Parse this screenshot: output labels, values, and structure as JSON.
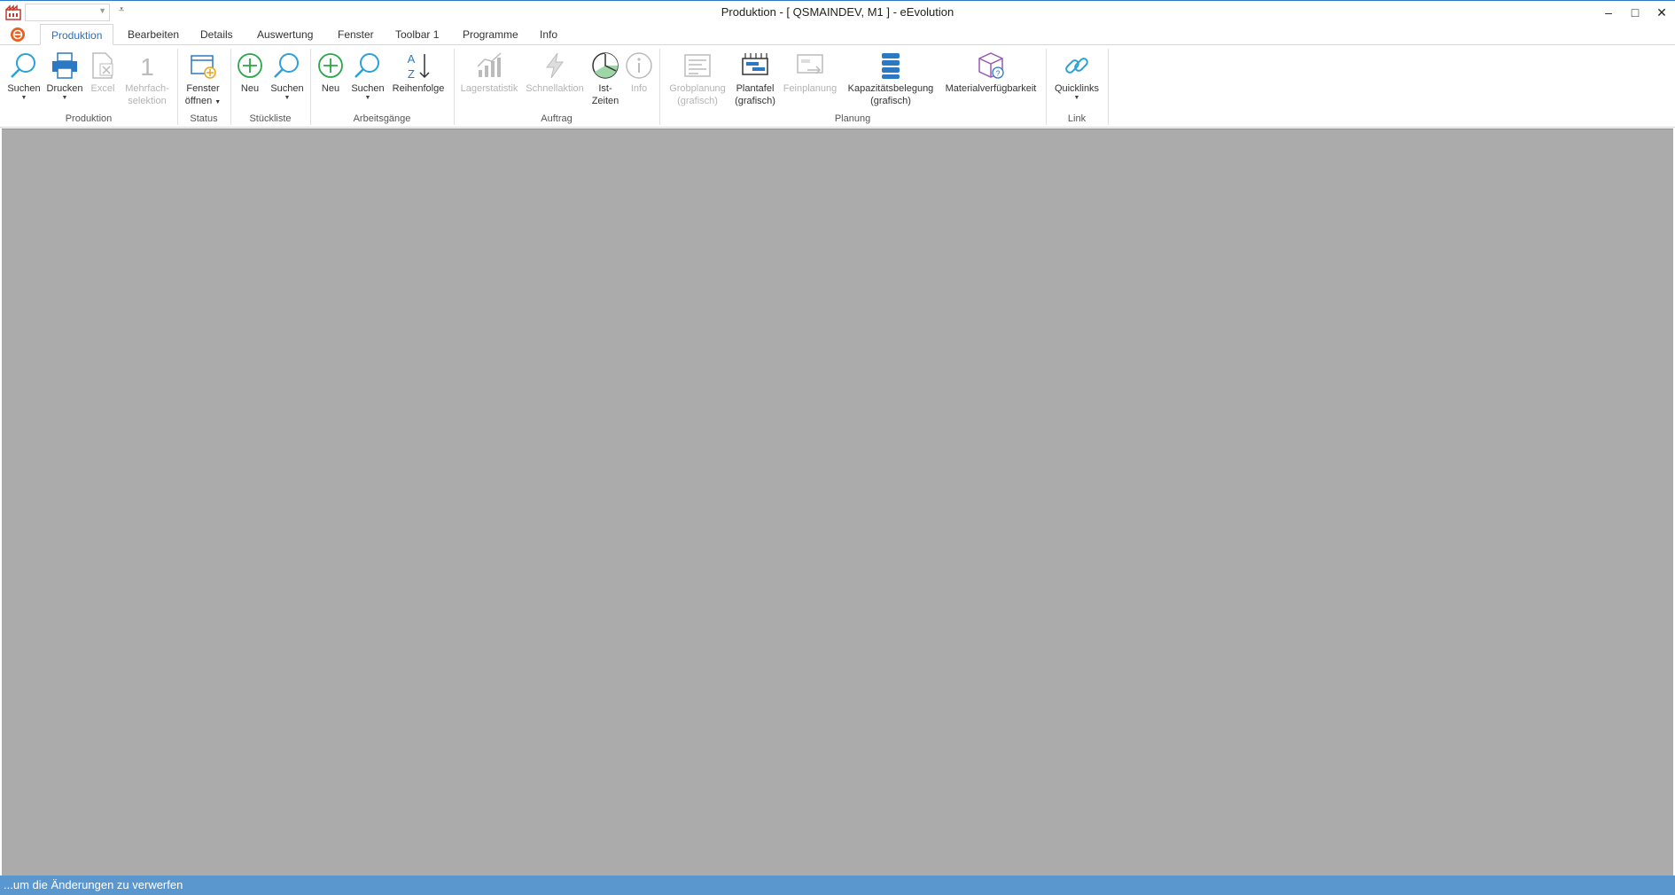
{
  "window": {
    "title": "Produktion - [ QSMAINDEV, M1 ]  -  eEvolution",
    "controls": [
      "–",
      "□",
      "✕"
    ]
  },
  "tabs": [
    "Produktion",
    "Bearbeiten",
    "Details",
    "Auswertung",
    "Fenster",
    "Toolbar 1",
    "Programme",
    "Info"
  ],
  "ribbon": {
    "groups": {
      "produktion": "Produktion",
      "status": "Status",
      "stueckliste": "Stückliste",
      "arbeitsgaenge": "Arbeitsgänge",
      "auftrag": "Auftrag",
      "planung": "Planung",
      "link": "Link"
    },
    "buttons": {
      "suchen1": "Suchen",
      "drucken": "Drucken",
      "excel": "Excel",
      "mehrfach1": "Mehrfach-",
      "mehrfach2": "selektion",
      "fenster1": "Fenster",
      "fenster2": "öffnen",
      "neu1": "Neu",
      "suchen2": "Suchen",
      "neu2": "Neu",
      "suchen3": "Suchen",
      "reihenfolge": "Reihenfolge",
      "lagerstatistik": "Lagerstatistik",
      "schnellaktion": "Schnellaktion",
      "ist1": "Ist-",
      "ist2": "Zeiten",
      "info": "Info",
      "grob1": "Grobplanung",
      "grob2": "(grafisch)",
      "plantafel1": "Plantafel",
      "plantafel2": "(grafisch)",
      "feinplanung": "Feinplanung",
      "kap1": "Kapazitätsbelegung",
      "kap2": "(grafisch)",
      "material": "Materialverfügbarkeit",
      "quicklinks": "Quicklinks"
    }
  },
  "statusbar": {
    "text": "...um die Änderungen zu verwerfen"
  },
  "colors": {
    "accent": "#2b6fbc",
    "workspace": "#ababab",
    "status": "#5b97cf"
  }
}
